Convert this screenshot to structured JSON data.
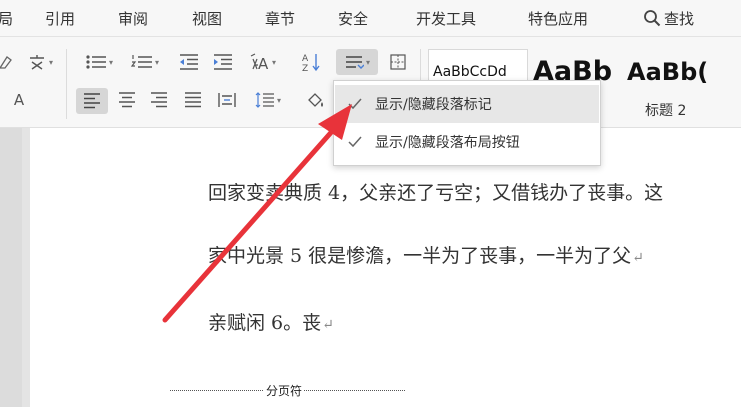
{
  "menubar": {
    "items": [
      "局",
      "引用",
      "审阅",
      "视图",
      "章节",
      "安全",
      "开发工具",
      "特色应用"
    ],
    "search_label": "查找"
  },
  "ribbon": {
    "font_color_char": "A",
    "heading_text_a": "A",
    "style_gallery": {
      "normal_preview": "AaBbCcDd",
      "h1_preview": "AaBb",
      "h2_preview": "AaBb(",
      "h2_label": "标题 2"
    }
  },
  "dropdown": {
    "items": [
      {
        "label": "显示/隐藏段落标记",
        "checked": true
      },
      {
        "label": "显示/隐藏段落布局按钮",
        "checked": true
      }
    ]
  },
  "document": {
    "lines": [
      "回家变卖典质 4，父亲还了亏空；又借钱办了丧事。这",
      "家中光景 5 很是惨澹，一半为了丧事，一半为了父",
      "亲赋闲 6。丧"
    ],
    "page_break_label": "分页符"
  },
  "colors": {
    "arrow": "#e8333a",
    "menubar_bg": "#f7f7f7",
    "dropdown_hover": "#e7e7e7"
  }
}
